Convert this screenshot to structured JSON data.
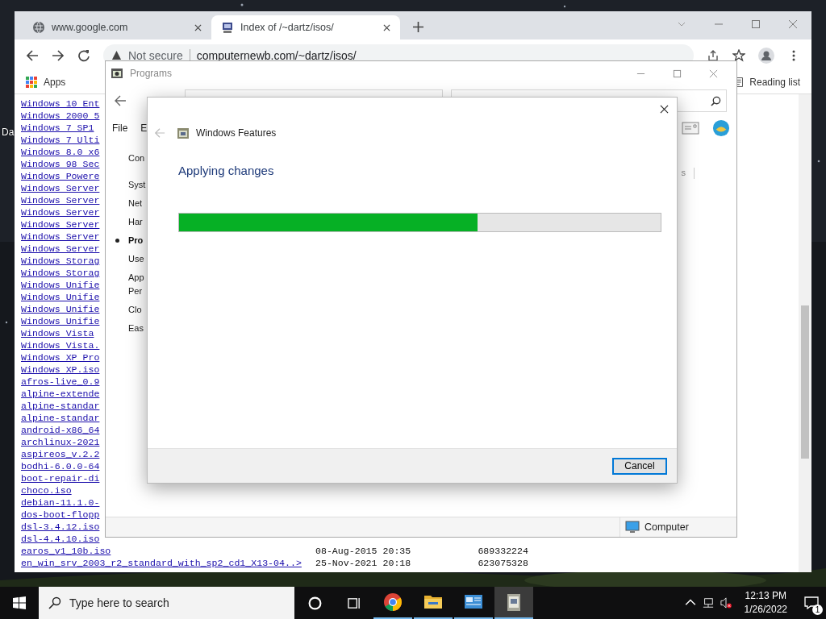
{
  "desktop": {
    "icon_label": "Da"
  },
  "browser": {
    "tabs": [
      {
        "title": "www.google.com",
        "selected": false
      },
      {
        "title": "Index of /~dartz/isos/",
        "selected": true
      }
    ],
    "security": "Not secure",
    "url": "computernewb.com/~dartz/isos/",
    "apps": "Apps",
    "reading_list": "Reading list",
    "listing": [
      {
        "name": "Windows 10 Ent"
      },
      {
        "name": "Windows 2000 5"
      },
      {
        "name": "Windows 7 SP1"
      },
      {
        "name": "Windows 7 Ulti"
      },
      {
        "name": "Windows 8.0 x6"
      },
      {
        "name": "Windows 98 Sec"
      },
      {
        "name": "Windows Powere"
      },
      {
        "name": "Windows Server"
      },
      {
        "name": "Windows Server"
      },
      {
        "name": "Windows Server"
      },
      {
        "name": "Windows Server"
      },
      {
        "name": "Windows Server"
      },
      {
        "name": "Windows Server"
      },
      {
        "name": "Windows Storag"
      },
      {
        "name": "Windows Storag"
      },
      {
        "name": "Windows Unifie"
      },
      {
        "name": "Windows Unifie"
      },
      {
        "name": "Windows Unifie"
      },
      {
        "name": "Windows Unifie"
      },
      {
        "name": "Windows Vista"
      },
      {
        "name": "Windows Vista."
      },
      {
        "name": "Windows XP Pro"
      },
      {
        "name": "Windows XP.iso"
      },
      {
        "name": "afros-live_0.9"
      },
      {
        "name": "alpine-extende"
      },
      {
        "name": "alpine-standar"
      },
      {
        "name": "alpine-standar"
      },
      {
        "name": "android-x86_64"
      },
      {
        "name": "archlinux-2021"
      },
      {
        "name": "aspireos_v.2.2"
      },
      {
        "name": "bodhi-6.0.0-64"
      },
      {
        "name": "boot-repair-di"
      },
      {
        "name": "choco.iso"
      },
      {
        "name": "debian-11.1.0-"
      },
      {
        "name": "dos-boot-flopp"
      },
      {
        "name": "dsl-3.4.12.iso"
      },
      {
        "name": "dsl-4.4.10.iso"
      },
      {
        "name": "earos_v1_10b.iso",
        "date": "08-Aug-2015 20:35",
        "size": "689332224"
      },
      {
        "name": "en_win_srv_2003_r2_standard_with_sp2_cd1_X13-04..>",
        "date": "25-Nov-2021 20:18",
        "size": "623075328"
      }
    ]
  },
  "programs_window": {
    "title": "Programs",
    "menu": [
      "File",
      "E"
    ],
    "sidebar": [
      {
        "lines": [
          "Con"
        ],
        "selected": false
      },
      {
        "lines": [
          "Syst"
        ],
        "selected": false
      },
      {
        "lines": [
          "Net"
        ],
        "selected": false
      },
      {
        "lines": [
          "Har"
        ],
        "selected": false
      },
      {
        "lines": [
          "Pro"
        ],
        "selected": true
      },
      {
        "lines": [
          "Use"
        ],
        "selected": false
      },
      {
        "lines": [
          "App",
          "Per"
        ],
        "selected": false
      },
      {
        "lines": [
          "Clo"
        ],
        "selected": false
      },
      {
        "lines": [
          "Eas"
        ],
        "selected": false
      }
    ],
    "fragment": "s",
    "status": "Computer"
  },
  "dialog": {
    "title": "Windows Features",
    "heading": "Applying changes",
    "progress": {
      "level": 0.62
    },
    "cancel": "Cancel"
  },
  "taskbar": {
    "search_placeholder": "Type here to search",
    "apps": [
      {
        "kind": "chrome",
        "selected": false
      },
      {
        "kind": "explorer",
        "selected": false
      },
      {
        "kind": "control-panel",
        "selected": false
      },
      {
        "kind": "features",
        "selected": true
      }
    ],
    "time": "12:13 PM",
    "date": "1/26/2022",
    "notifications": "1"
  }
}
